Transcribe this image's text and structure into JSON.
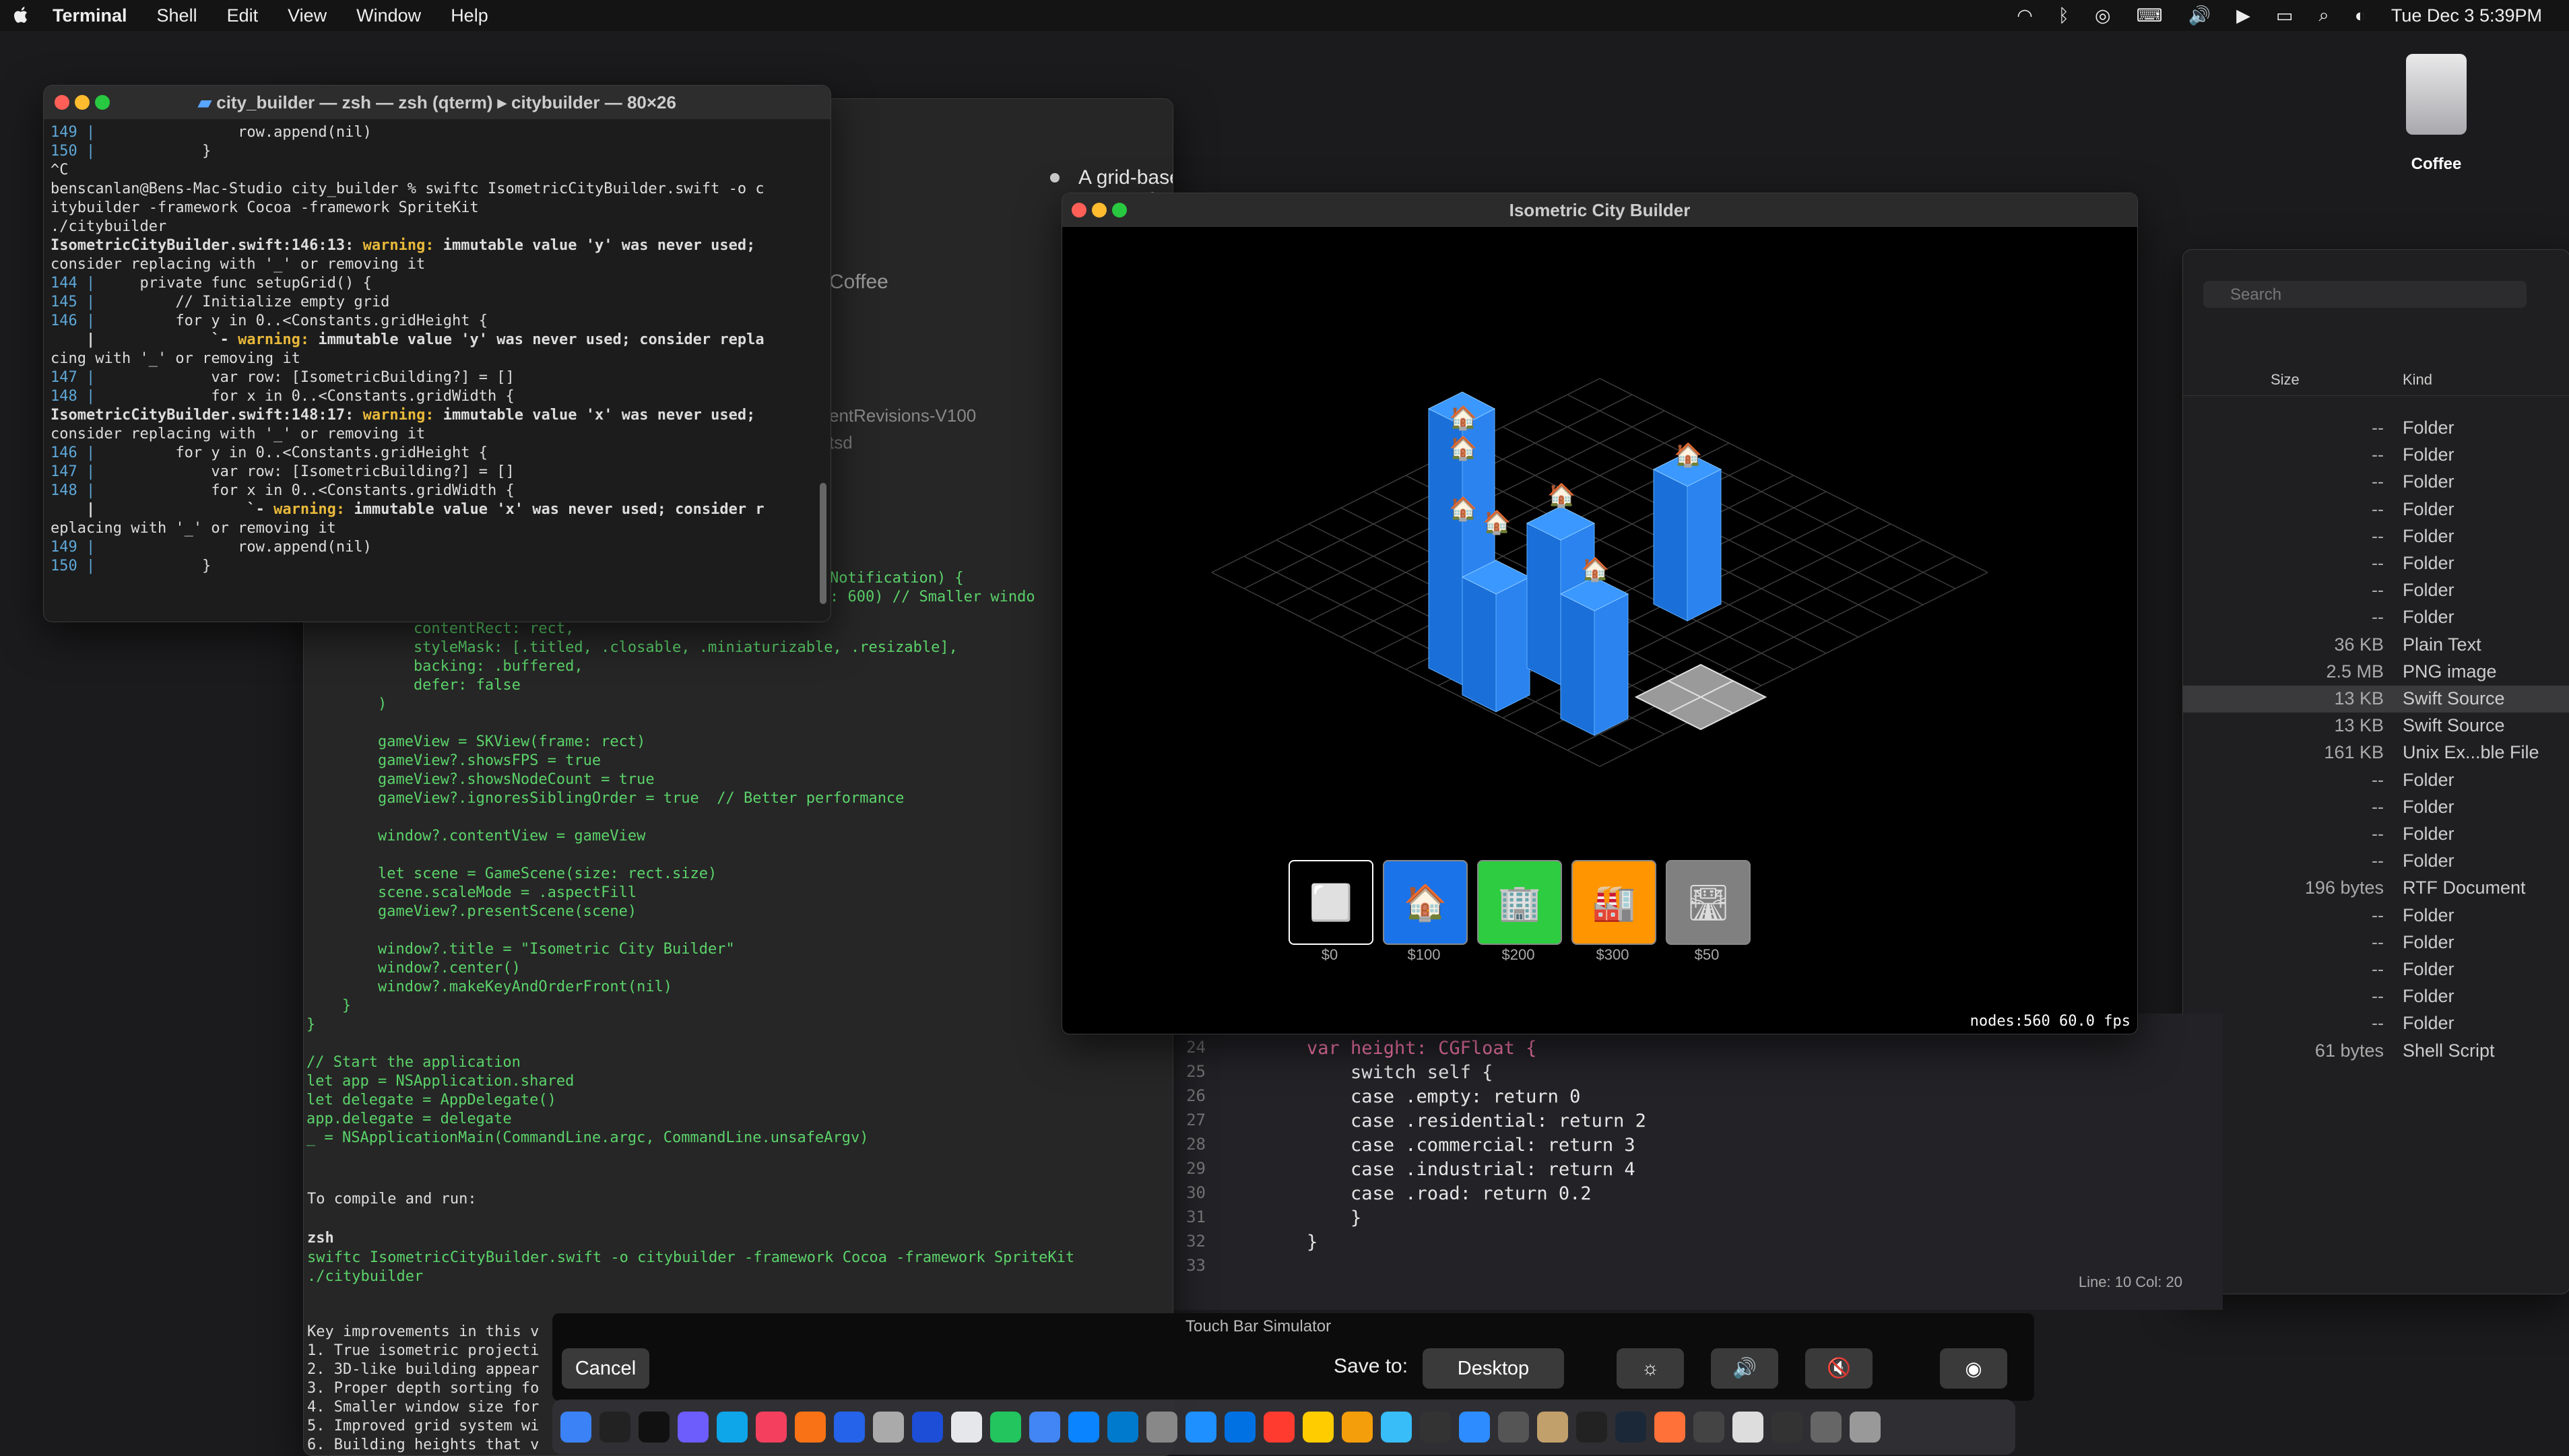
{
  "menubar": {
    "app": "Terminal",
    "items": [
      "Shell",
      "Edit",
      "View",
      "Window",
      "Help"
    ],
    "datetime": "Tue Dec 3  5:39PM"
  },
  "desktop": {
    "drive_label": "Coffee"
  },
  "terminal": {
    "title": "city_builder — zsh — zsh (qterm) ▸ citybuilder — 80×26",
    "lines": [
      "149 |                row.append(nil)",
      "150 |            }",
      "^C",
      "benscanlan@Bens-Mac-Studio city_builder % swiftc IsometricCityBuilder.swift -o c",
      "itybuilder -framework Cocoa -framework SpriteKit",
      "./citybuilder",
      "IsometricCityBuilder.swift:146:13: warning: immutable value 'y' was never used;",
      "consider replacing with '_' or removing it",
      "144 |     private func setupGrid() {",
      "145 |         // Initialize empty grid",
      "146 |         for y in 0..<Constants.gridHeight {",
      "    |             `- warning: immutable value 'y' was never used; consider repla",
      "cing with '_' or removing it",
      "147 |             var row: [IsometricBuilding?] = []",
      "148 |             for x in 0..<Constants.gridWidth {",
      "",
      "IsometricCityBuilder.swift:148:17: warning: immutable value 'x' was never used;",
      "consider replacing with '_' or removing it",
      "146 |         for y in 0..<Constants.gridHeight {",
      "147 |             var row: [IsometricBuilding?] = []",
      "148 |             for x in 0..<Constants.gridWidth {",
      "    |                 `- warning: immutable value 'x' was never used; consider r",
      "eplacing with '_' or removing it",
      "149 |                row.append(nil)",
      "150 |            }"
    ]
  },
  "chat": {
    "bullet_text": "A grid-based system for placing buildings and infrastructure",
    "sidebar_title": "Coffee",
    "list_items": [
      "entRevisions-V100",
      "tsd"
    ],
    "notification_frag": "Notification) {",
    "smaller_frag": ": 600)  // Smaller windo",
    "code": "            contentRect: rect,\n            styleMask: [.titled, .closable, .miniaturizable, .resizable],\n            backing: .buffered,\n            defer: false\n        )\n\n        gameView = SKView(frame: rect)\n        gameView?.showsFPS = true\n        gameView?.showsNodeCount = true\n        gameView?.ignoresSiblingOrder = true  // Better performance\n\n        window?.contentView = gameView\n\n        let scene = GameScene(size: rect.size)\n        scene.scaleMode = .aspectFill\n        gameView?.presentScene(scene)\n\n        window?.title = \"Isometric City Builder\"\n        window?.center()\n        window?.makeKeyAndOrderFront(nil)\n    }\n}\n\n// Start the application\nlet app = NSApplication.shared\nlet delegate = AppDelegate()\napp.delegate = delegate\n_ = NSApplicationMain(CommandLine.argc, CommandLine.unsafeArgv)",
    "compile_heading": "To compile and run:",
    "shell_label": "zsh",
    "compile_cmd": "swiftc IsometricCityBuilder.swift -o citybuilder -framework Cocoa -framework SpriteKit\n./citybuilder",
    "improvements": [
      "Key improvements in this v",
      "1. True isometric projecti",
      "2. 3D-like building appear",
      "3. Proper depth sorting fo",
      "4. Smaller window size for",
      "5. Improved grid system wi",
      "6. Building heights that v"
    ]
  },
  "game": {
    "title": "Isometric City Builder",
    "tools": [
      {
        "icon": "empty-icon",
        "glyph": "⬜",
        "cost": "$0",
        "color": "#000000"
      },
      {
        "icon": "house-icon",
        "glyph": "🏠",
        "cost": "$100",
        "color": "#1a73e8"
      },
      {
        "icon": "office-icon",
        "glyph": "🏢",
        "cost": "$200",
        "color": "#2ecc40"
      },
      {
        "icon": "factory-icon",
        "glyph": "🏭",
        "cost": "$300",
        "color": "#ff9500"
      },
      {
        "icon": "road-icon",
        "glyph": "🛣",
        "cost": "$50",
        "color": "#808080"
      }
    ],
    "stats": "nodes:560   60.0 fps"
  },
  "xcode": {
    "lines": [
      {
        "n": "24",
        "code": "var height: CGFloat {"
      },
      {
        "n": "25",
        "code": "    switch self {"
      },
      {
        "n": "26",
        "code": "    case .empty: return 0"
      },
      {
        "n": "27",
        "code": "    case .residential: return 2"
      },
      {
        "n": "28",
        "code": "    case .commercial: return 3"
      },
      {
        "n": "29",
        "code": "    case .industrial: return 4"
      },
      {
        "n": "30",
        "code": "    case .road: return 0.2"
      },
      {
        "n": "31",
        "code": "    }"
      },
      {
        "n": "32",
        "code": "}"
      },
      {
        "n": "33",
        "code": ""
      }
    ],
    "status": "Line: 10  Col: 20"
  },
  "finder": {
    "columns": {
      "size": "Size",
      "kind": "Kind"
    },
    "search_placeholder": "Search",
    "rows": [
      {
        "size": "--",
        "kind": "Folder"
      },
      {
        "size": "--",
        "kind": "Folder"
      },
      {
        "size": "--",
        "kind": "Folder"
      },
      {
        "size": "--",
        "kind": "Folder"
      },
      {
        "size": "--",
        "kind": "Folder"
      },
      {
        "size": "--",
        "kind": "Folder"
      },
      {
        "size": "--",
        "kind": "Folder"
      },
      {
        "size": "--",
        "kind": "Folder"
      },
      {
        "size": "36 KB",
        "kind": "Plain Text"
      },
      {
        "size": "2.5 MB",
        "kind": "PNG image"
      },
      {
        "size": "13 KB",
        "kind": "Swift Source"
      },
      {
        "size": "13 KB",
        "kind": "Swift Source"
      },
      {
        "size": "161 KB",
        "kind": "Unix Ex...ble File"
      },
      {
        "size": "--",
        "kind": "Folder"
      },
      {
        "size": "--",
        "kind": "Folder"
      },
      {
        "size": "--",
        "kind": "Folder"
      },
      {
        "size": "--",
        "kind": "Folder"
      },
      {
        "size": "196 bytes",
        "kind": "RTF Document"
      },
      {
        "size": "--",
        "kind": "Folder"
      },
      {
        "size": "--",
        "kind": "Folder"
      },
      {
        "size": "--",
        "kind": "Folder"
      },
      {
        "size": "--",
        "kind": "Folder"
      },
      {
        "size": "--",
        "kind": "Folder"
      },
      {
        "size": "61 bytes",
        "kind": "Shell Script"
      }
    ],
    "lower_rows": [
      {
        "size": "--",
        "kind": "Folder"
      },
      {
        "size": "196 bytes",
        "kind": "RTF Document"
      },
      {
        "size": "--",
        "kind": "Folder"
      },
      {
        "size": "--",
        "kind": "Folder"
      },
      {
        "size": "--",
        "kind": "Folder"
      },
      {
        "size": "--",
        "kind": "Folder"
      }
    ]
  },
  "touchbar": {
    "title": "Touch Bar Simulator",
    "cancel": "Cancel",
    "save_to": "Save to:",
    "destination": "Desktop"
  }
}
